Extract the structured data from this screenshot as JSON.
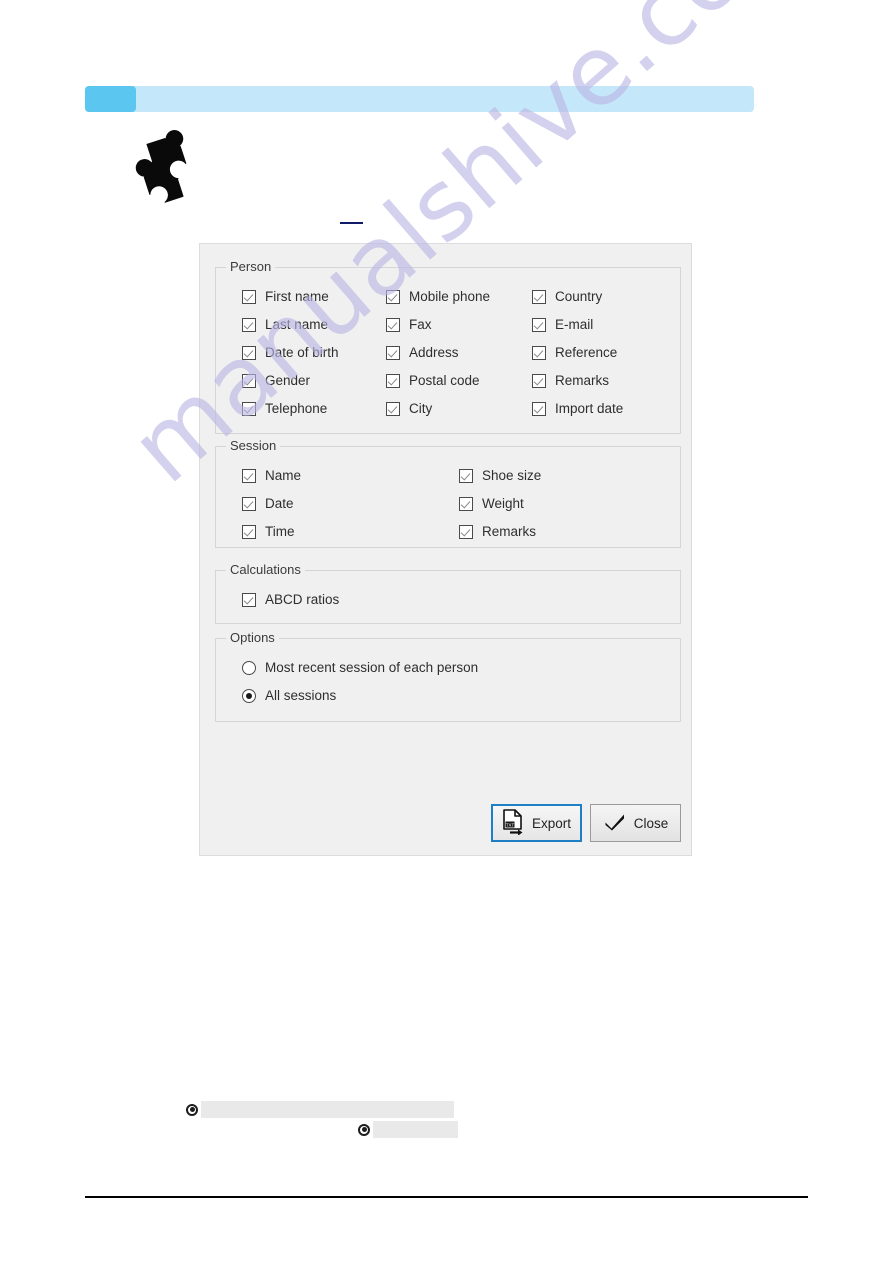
{
  "page": {
    "header_banner": {
      "tab_icon": "blue-tab",
      "accent_color": "#5bc6f0",
      "banner_color": "#c5e7fa"
    },
    "puzzle_icon": "puzzle-piece-icon",
    "watermark": "manualshive.com"
  },
  "dialog": {
    "groups": [
      {
        "id": "person",
        "title": "Person",
        "columns": [
          [
            {
              "label": "First name",
              "checked": true
            },
            {
              "label": "Last name",
              "checked": true
            },
            {
              "label": "Date of birth",
              "checked": true
            },
            {
              "label": "Gender",
              "checked": true
            },
            {
              "label": "Telephone",
              "checked": true
            }
          ],
          [
            {
              "label": "Mobile phone",
              "checked": true
            },
            {
              "label": "Fax",
              "checked": true
            },
            {
              "label": "Address",
              "checked": true
            },
            {
              "label": "Postal code",
              "checked": true
            },
            {
              "label": "City",
              "checked": true
            }
          ],
          [
            {
              "label": "Country",
              "checked": true
            },
            {
              "label": "E-mail",
              "checked": true
            },
            {
              "label": "Reference",
              "checked": true
            },
            {
              "label": "Remarks",
              "checked": true
            },
            {
              "label": "Import date",
              "checked": true
            }
          ]
        ]
      },
      {
        "id": "session",
        "title": "Session",
        "columns": [
          [
            {
              "label": "Name",
              "checked": true
            },
            {
              "label": "Date",
              "checked": true
            },
            {
              "label": "Time",
              "checked": true
            }
          ],
          [
            {
              "label": "Shoe size",
              "checked": true
            },
            {
              "label": "Weight",
              "checked": true
            },
            {
              "label": "Remarks",
              "checked": true
            }
          ]
        ]
      },
      {
        "id": "calculations",
        "title": "Calculations",
        "columns": [
          [
            {
              "label": "ABCD ratios",
              "checked": true
            }
          ]
        ]
      }
    ],
    "options": {
      "title": "Options",
      "radios": [
        {
          "label": "Most recent session of each person",
          "selected": false
        },
        {
          "label": "All sessions",
          "selected": true
        }
      ]
    },
    "buttons": {
      "export": {
        "label": "Export",
        "icon": "txt-file-export-icon",
        "focused": true
      },
      "close": {
        "label": "Close",
        "icon": "checkmark-icon"
      }
    }
  },
  "bullets": [
    {
      "redacted": true
    },
    {
      "redacted": true
    }
  ],
  "colors": {
    "dialog_bg": "#f0f0f0",
    "focus_border": "#1e7fc4",
    "watermark": "#b9b6e4"
  }
}
